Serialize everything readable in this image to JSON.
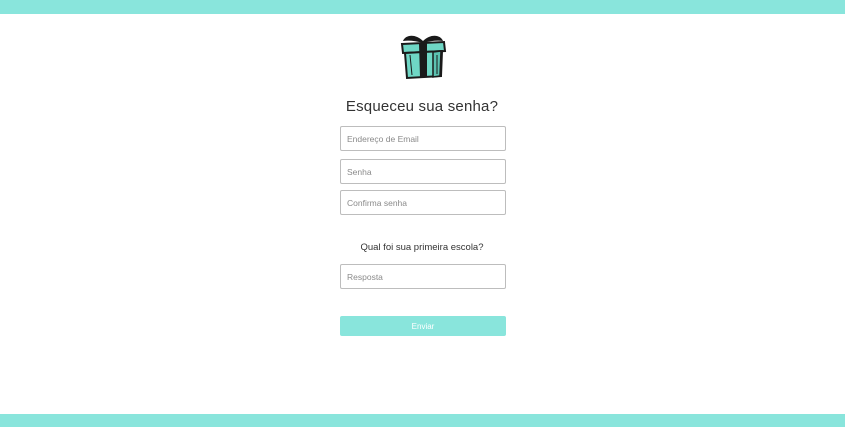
{
  "colors": {
    "accent": "#89e5dc",
    "gift_body": "#6fd7c5",
    "outline": "#1a1a1a"
  },
  "logo": {
    "icon": "gift-box-icon"
  },
  "title": "Esqueceu sua senha?",
  "fields": {
    "email_placeholder": "Endereço de Email",
    "password_placeholder": "Senha",
    "confirm_placeholder": "Confirma senha"
  },
  "security_question": {
    "label": "Qual foi sua primeira escola?",
    "answer_placeholder": "Resposta"
  },
  "submit_label": "Enviar"
}
